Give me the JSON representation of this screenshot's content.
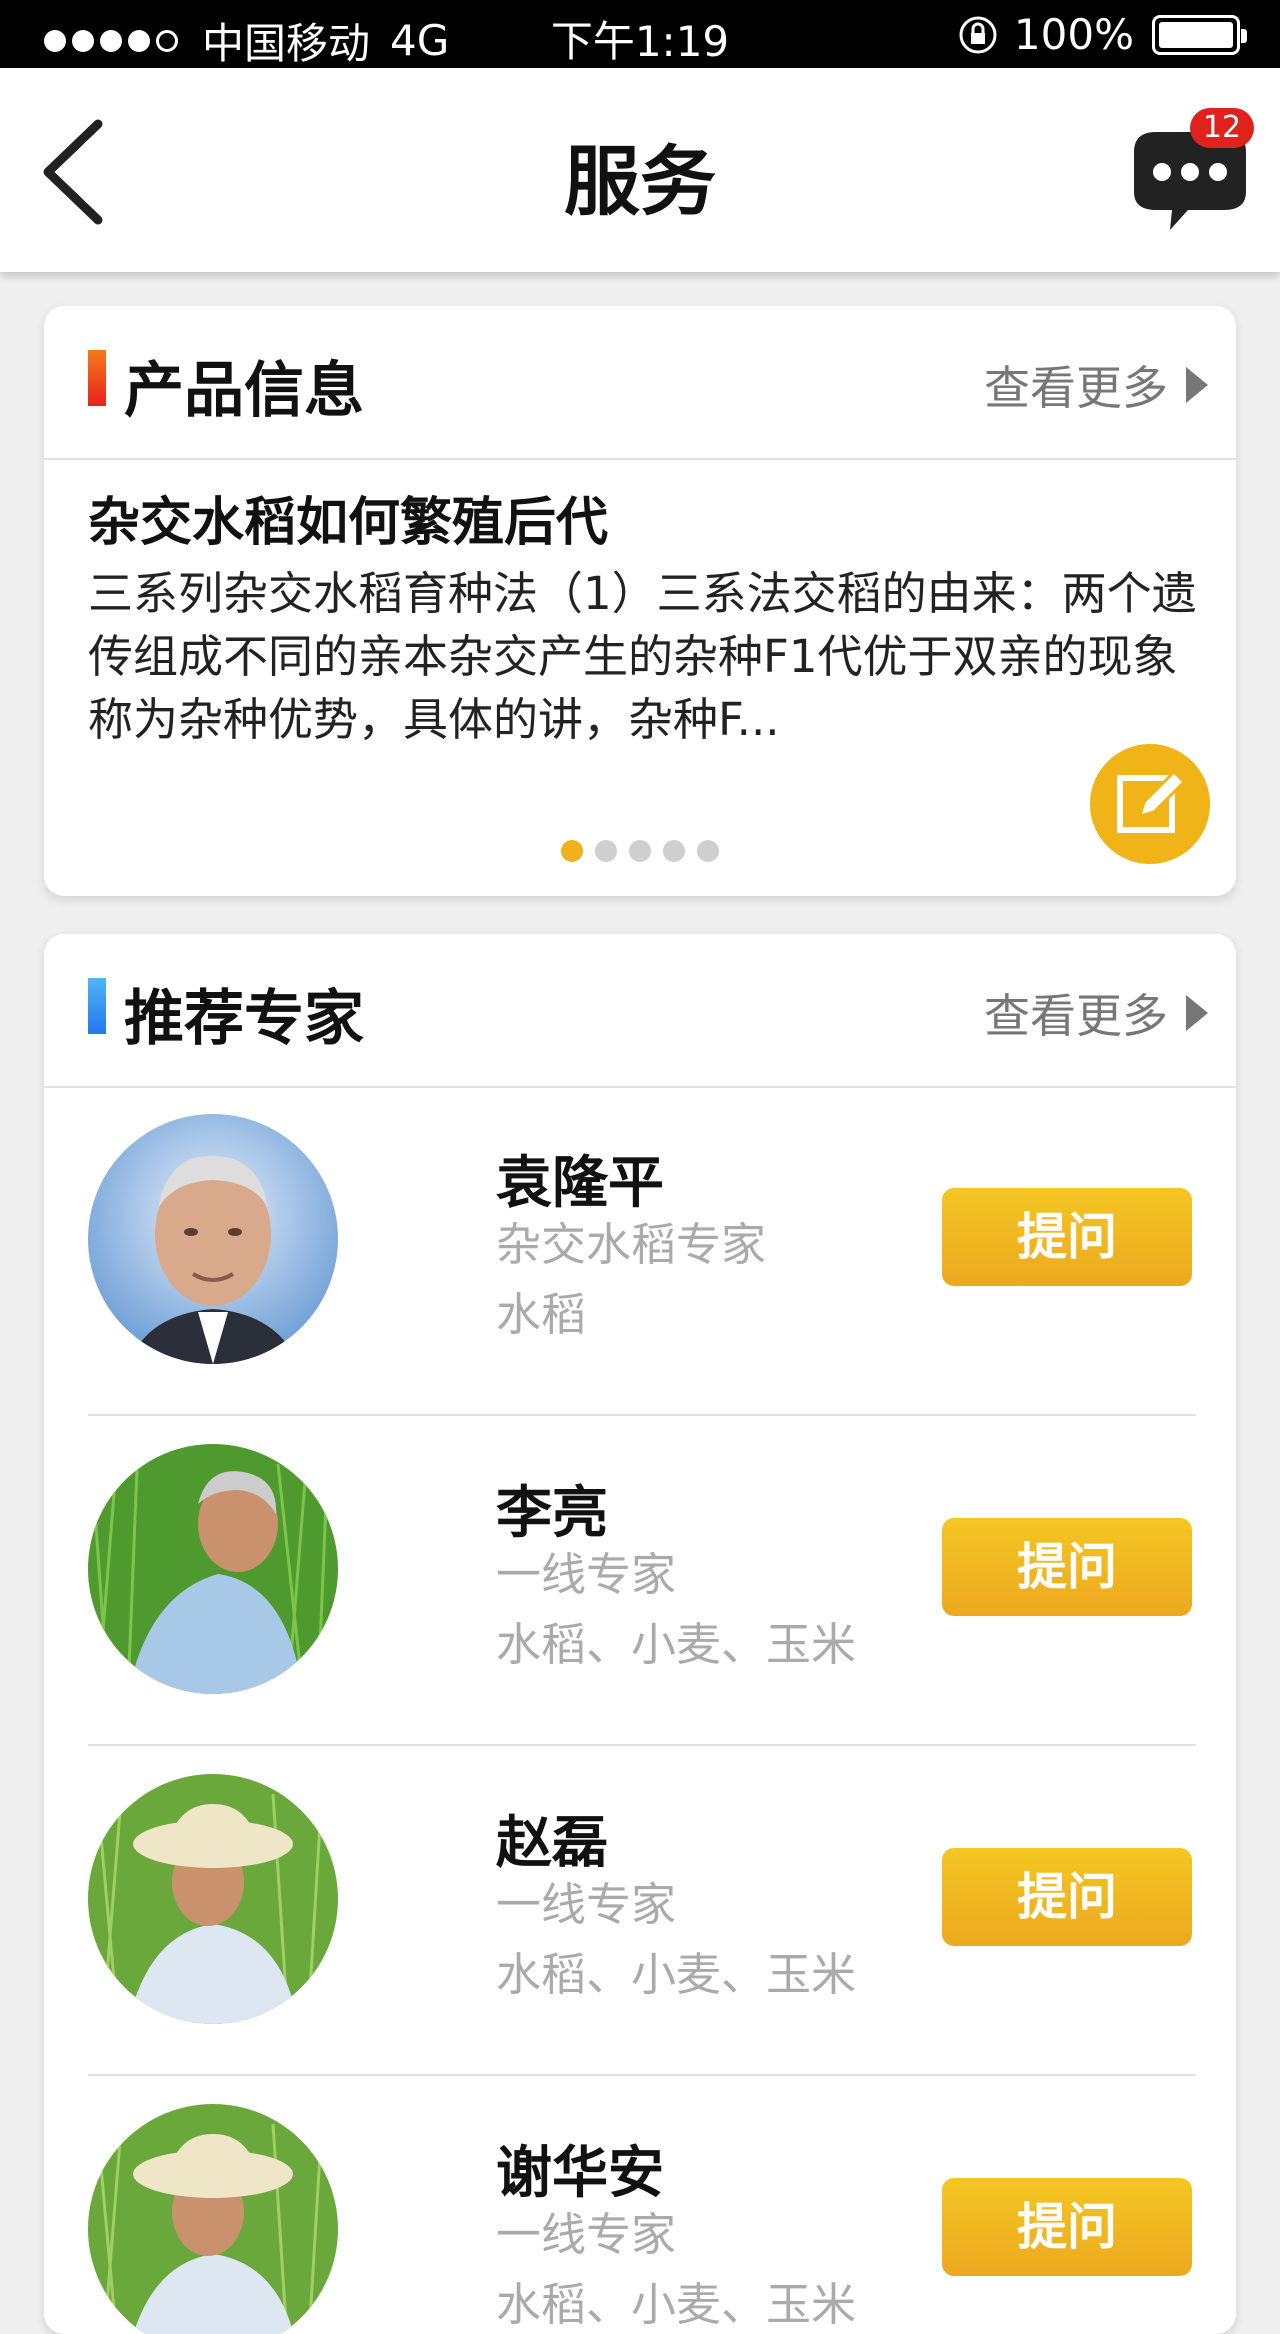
{
  "status_bar": {
    "carrier": "中国移动",
    "network": "4G",
    "time": "下午1:19",
    "battery": "100%"
  },
  "nav": {
    "title": "服务",
    "message_badge": "12"
  },
  "product_section": {
    "title": "产品信息",
    "more_label": "查看更多",
    "accent_color": "#f04a1e",
    "article_title": "杂交水稻如何繁殖后代",
    "article_excerpt": "三系列杂交水稻育种法（1）三系法交稻的由来：两个遗传组成不同的亲本杂交产生的杂种F1代优于双亲的现象称为杂种优势，具体的讲，杂种F...",
    "page_count": 5,
    "active_page": 1
  },
  "experts_section": {
    "title": "推荐专家",
    "more_label": "查看更多",
    "accent_color": "#2a8cf0",
    "experts": [
      {
        "name": "袁隆平",
        "title": "杂交水稻专家",
        "tags": "水稻",
        "button": "提问"
      },
      {
        "name": "李亮",
        "title": "一线专家",
        "tags": "水稻、小麦、玉米",
        "button": "提问"
      },
      {
        "name": "赵磊",
        "title": "一线专家",
        "tags": "水稻、小麦、玉米",
        "button": "提问"
      },
      {
        "name": "谢华安",
        "title": "一线专家",
        "tags": "水稻、小麦、玉米",
        "button": "提问"
      }
    ]
  },
  "colors": {
    "button_yellow": "#f0b21c",
    "badge_red": "#e0221c"
  }
}
